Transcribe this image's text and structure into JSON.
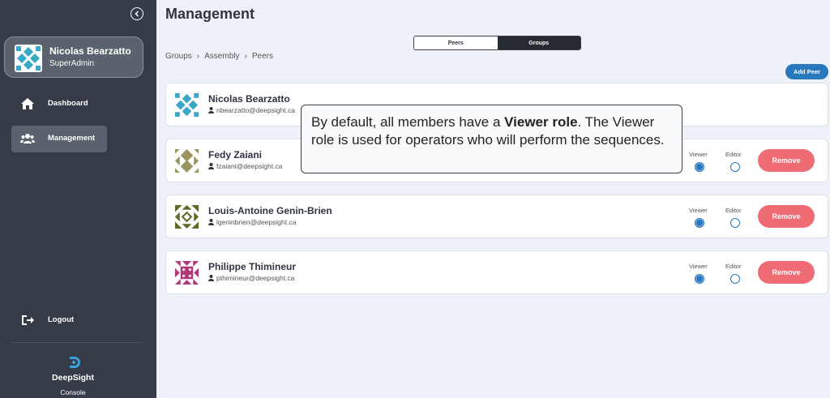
{
  "sidebar": {
    "user_name": "Nicolas Bearzatto",
    "user_role": "SuperAdmin",
    "nav": [
      {
        "label": "Dashboard",
        "icon": "home-icon"
      },
      {
        "label": "Management",
        "icon": "users-icon"
      }
    ],
    "logout_label": "Logout",
    "brand_name": "DeepSight",
    "brand_sub": "Console"
  },
  "header": {
    "title": "Management",
    "tabs": [
      "Peers",
      "Groups"
    ],
    "active_tab": "Groups",
    "breadcrumb": [
      "Groups",
      "Assembly",
      "Peers"
    ],
    "add_peer_label": "Add Peer"
  },
  "peers": [
    {
      "name": "Nicolas Bearzatto",
      "email": "nbearzatto@deepsight.ca",
      "avatar_color": "#3aa9c7"
    },
    {
      "name": "Fedy Zaiani",
      "email": "fzaiani@deepsight.ca",
      "avatar_color": "#9a9560",
      "role": "Viewer"
    },
    {
      "name": "Louis-Antoine Genin-Brien",
      "email": "lgeninbrien@deepsight.ca",
      "avatar_color": "#5d6b23",
      "role": "Viewer"
    },
    {
      "name": "Philippe Thimineur",
      "email": "pthimineur@deepsight.ca",
      "avatar_color": "#b3387a",
      "role": "Viewer"
    }
  ],
  "roles": {
    "viewer": "Viewer",
    "editor": "Editor"
  },
  "remove_label": "Remove",
  "tooltip": {
    "pre": "By default, all members have a ",
    "bold": "Viewer role",
    "post": ". The Viewer role is used for operators who will perform the sequences."
  },
  "colors": {
    "sidebar": "#353c48",
    "accent": "#2878be",
    "remove": "#f06c74",
    "background": "#eef2f8"
  }
}
